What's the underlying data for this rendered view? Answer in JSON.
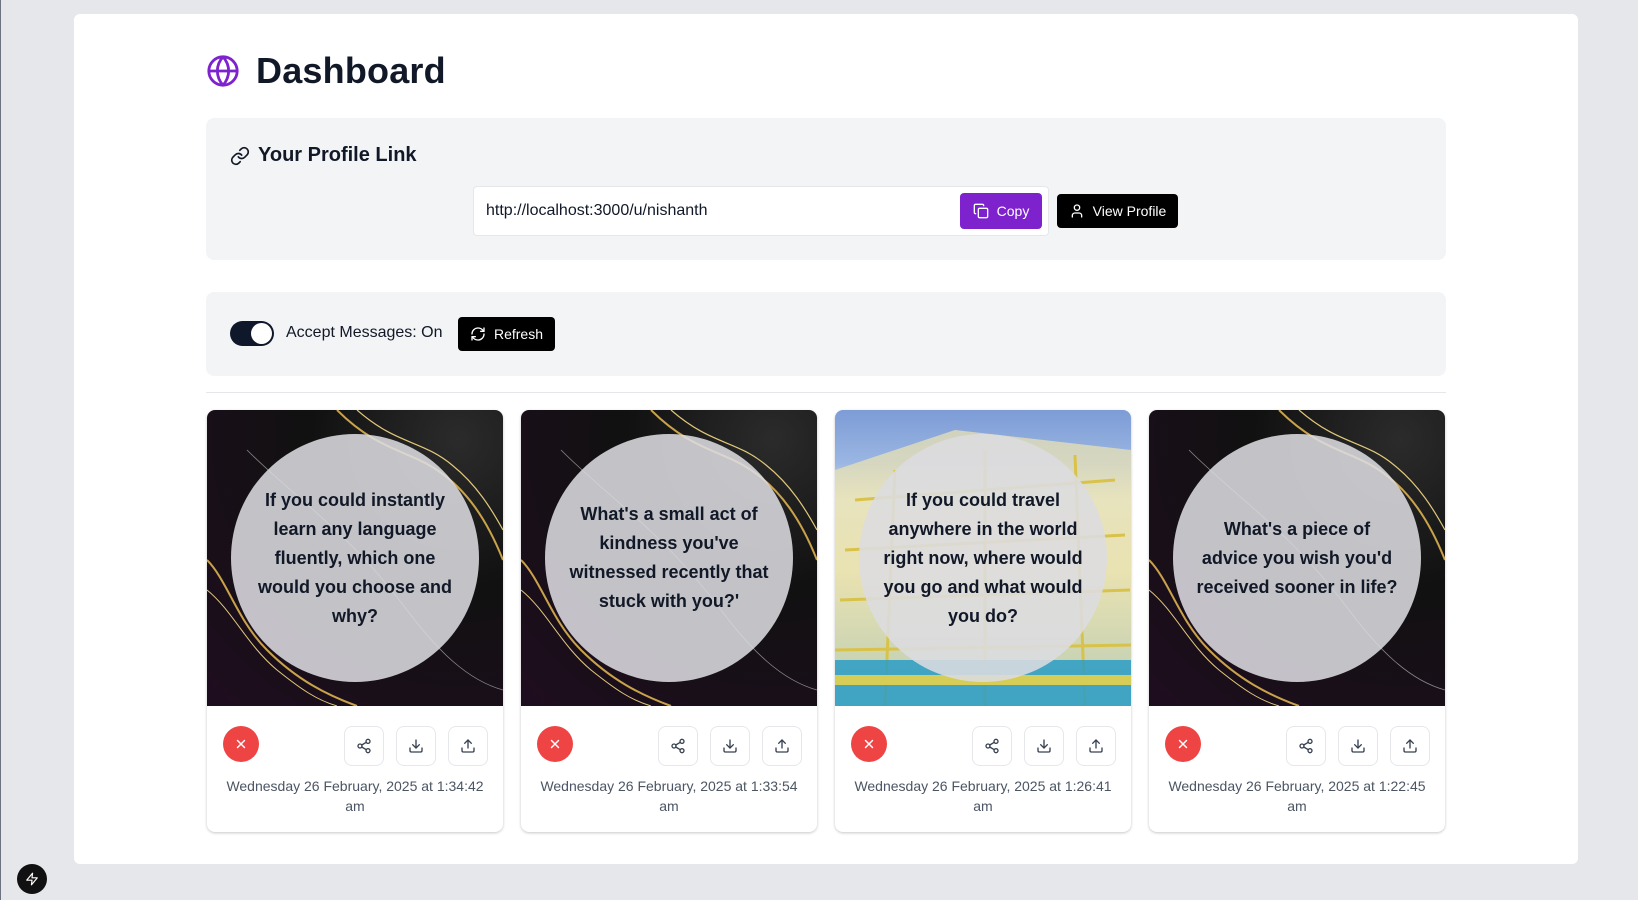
{
  "header": {
    "title": "Dashboard",
    "icon": "globe-icon",
    "accent": "#7e22ce"
  },
  "profile": {
    "title": "Your Profile Link",
    "link_value": "http://localhost:3000/u/nishanth",
    "copy_label": "Copy",
    "view_label": "View Profile"
  },
  "settings": {
    "accept_label": "Accept Messages: On",
    "accept_on": true,
    "refresh_label": "Refresh"
  },
  "cards": [
    {
      "question": "If you could instantly learn any language fluently, which one would you choose and why?",
      "date": "Wednesday 26 February, 2025 at 1:34:42 am",
      "background": "dark-marble-gold"
    },
    {
      "question": "What's a small act of kindness you've witnessed recently that stuck with you?'",
      "date": "Wednesday 26 February, 2025 at 1:33:54 am",
      "background": "dark-marble-gold"
    },
    {
      "question": "If you could travel anywhere in the world right now, where would you go and what would you do?",
      "date": "Wednesday 26 February, 2025 at 1:26:41 am",
      "background": "building-photo"
    },
    {
      "question": "What's a piece of advice you wish you'd received sooner in life?",
      "date": "Wednesday 26 February, 2025 at 1:22:45 am",
      "background": "dark-marble-gold"
    }
  ],
  "colors": {
    "delete": "#ef4444",
    "primary": "#7e22ce",
    "dark": "#000000"
  }
}
